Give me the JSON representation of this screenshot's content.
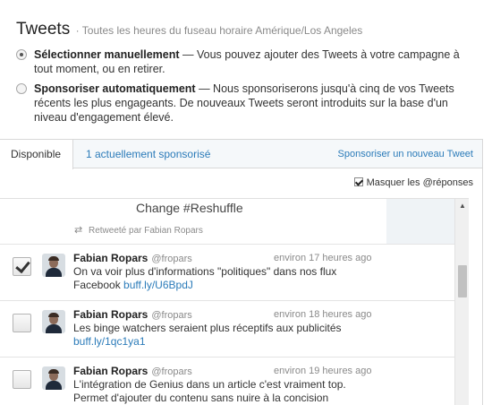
{
  "header": {
    "title": "Tweets",
    "subtitle": "· Toutes les heures du fuseau horaire Amérique/Los Angeles"
  },
  "options": [
    {
      "label": "Sélectionner manuellement",
      "description": " — Vous pouvez ajouter des Tweets à votre campagne à tout moment, ou en retirer.",
      "selected": true
    },
    {
      "label": "Sponsoriser automatiquement",
      "description": " — Nous sponsoriserons jusqu'à cinq de vos Tweets récents les plus engageants. De nouveaux Tweets seront introduits sur la base d'un niveau d'engagement élevé.",
      "selected": false
    }
  ],
  "tabs": {
    "available": "Disponible",
    "sponsored": "1 actuellement sponsorisé",
    "new_link": "Sponsoriser un nouveau Tweet"
  },
  "filters": {
    "hide_replies_label": "Masquer les @réponses",
    "hide_replies_checked": true
  },
  "partial_tweet": {
    "text": "Change #Reshuffle",
    "retweet_label": "Retweeté par Fabian Ropars"
  },
  "tweets": [
    {
      "author": "Fabian Ropars",
      "handle": "@fropars",
      "time": "environ 17 heures ago",
      "text": "On va voir plus d'informations \"politiques\" dans nos flux Facebook ",
      "link": "buff.ly/U6BpdJ",
      "checked": true
    },
    {
      "author": "Fabian Ropars",
      "handle": "@fropars",
      "time": "environ 18 heures ago",
      "text": "Les binge watchers seraient plus réceptifs aux publicités ",
      "link": "buff.ly/1qc1ya1",
      "checked": false
    },
    {
      "author": "Fabian Ropars",
      "handle": "@fropars",
      "time": "environ 19 heures ago",
      "text": "L'intégration de Genius dans un article c'est vraiment top. Permet d'ajouter du contenu sans nuire à la concision",
      "link": "",
      "checked": false
    }
  ],
  "colors": {
    "link": "#2b7bb9",
    "tab_bar": "#f5f8fa",
    "muted": "#8a8a8a"
  }
}
